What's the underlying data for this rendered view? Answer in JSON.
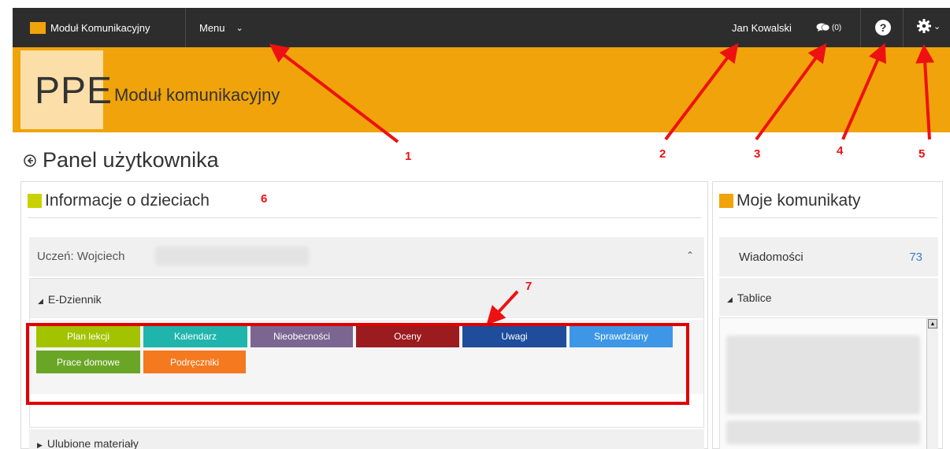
{
  "navbar": {
    "brand": "Moduł Komunikacyjny",
    "menu_label": "Menu",
    "user_name": "Jan Kowalski",
    "messages_count": "(0)",
    "help_icon": "question-circle-icon",
    "settings_icon": "gear-icon",
    "colors": {
      "background": "#2d2d2d",
      "accent": "#f0a30a"
    }
  },
  "header": {
    "logo_text": "PPE",
    "subtitle": "Moduł komunikacyjny",
    "colors": {
      "background": "#f0a30a",
      "logo_box": "#fcdfa8"
    }
  },
  "page": {
    "title": "Panel użytkownika",
    "back_icon": "circle-arrow-left-icon"
  },
  "children_panel": {
    "title": "Informacje o dzieciach",
    "title_square_color": "#c9d200",
    "student_label": "Uczeń: Wojciech",
    "collapse_icon": "double-chevron-up-icon",
    "ediary": {
      "label": "E-Dziennik",
      "tiles": [
        {
          "label": "Plan lekcji",
          "color": "#a3c300"
        },
        {
          "label": "Kalendarz",
          "color": "#1fb5ad"
        },
        {
          "label": "Nieobecności",
          "color": "#7b6691"
        },
        {
          "label": "Oceny",
          "color": "#9b1b1e"
        },
        {
          "label": "Uwagi",
          "color": "#1f4c9b"
        },
        {
          "label": "Sprawdziany",
          "color": "#3d97e6"
        },
        {
          "label": "Prace domowe",
          "color": "#6aa626"
        },
        {
          "label": "Podręczniki",
          "color": "#f4791f"
        }
      ]
    },
    "next_section_label": "Ulubione materiały"
  },
  "messages_panel": {
    "title": "Moje komunikaty",
    "title_square_color": "#f0a30a",
    "messages_label": "Wiadomości",
    "messages_count": "73",
    "boards_label": "Tablice"
  },
  "annotations": {
    "labels": [
      "1",
      "2",
      "3",
      "4",
      "5",
      "6",
      "7"
    ],
    "color": "#ee1111"
  }
}
